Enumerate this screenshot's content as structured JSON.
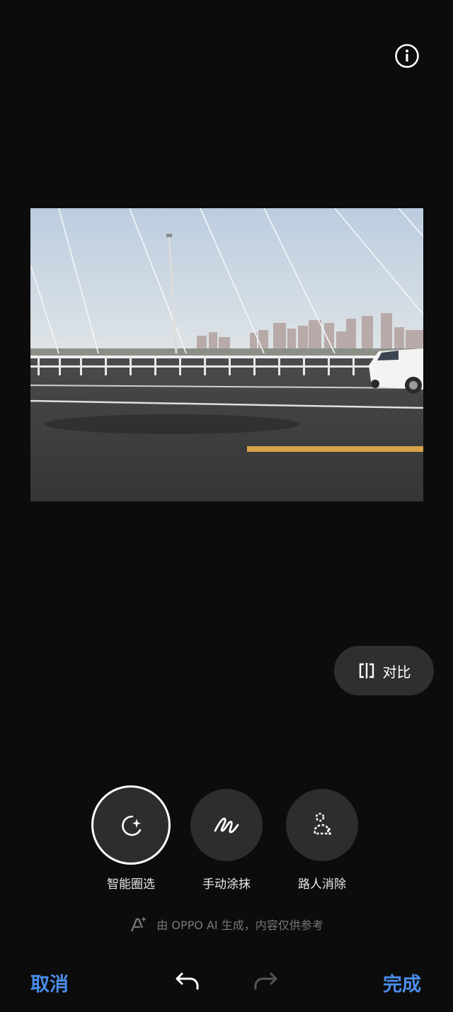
{
  "header": {
    "info_icon": "info-circle-icon"
  },
  "photo": {
    "description_icon": "photo-preview"
  },
  "compare": {
    "label": "对比",
    "icon": "compare-split-icon"
  },
  "tools": [
    {
      "label": "智能圈选",
      "icon": "smart-lasso-sparkle-icon",
      "selected": true
    },
    {
      "label": "手动涂抹",
      "icon": "brush-scribble-icon",
      "selected": false
    },
    {
      "label": "路人消除",
      "icon": "passerby-remove-icon",
      "selected": false
    }
  ],
  "disclaimer": {
    "text": "由 OPPO AI 生成，内容仅供参考",
    "icon": "ai-sparkle-icon"
  },
  "footer": {
    "cancel_label": "取消",
    "done_label": "完成",
    "undo_icon": "undo-icon",
    "redo_icon": "redo-icon"
  },
  "colors": {
    "accent": "#4a8de8",
    "background": "#0c0c0c",
    "button_bg": "#2d2d2d"
  }
}
